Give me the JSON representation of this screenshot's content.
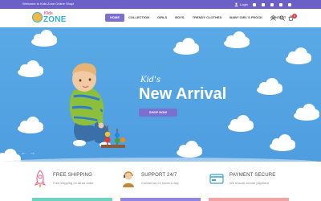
{
  "topbar": {
    "welcome": "Welcome to Kids Zone Online Shop!",
    "login": "Login",
    "socials": [
      "facebook-icon",
      "twitter-icon",
      "google-plus-icon",
      "instagram-icon",
      "pinterest-icon"
    ]
  },
  "header": {
    "logo": {
      "top": "Kids",
      "bottom": "ZONE"
    },
    "nav": [
      {
        "label": "HOME",
        "active": true
      },
      {
        "label": "COLLECTION"
      },
      {
        "label": "GIRLS"
      },
      {
        "label": "BOYS"
      },
      {
        "label": "TRENDY CLOTHES"
      },
      {
        "label": "BABY GIRL'S FROCK"
      },
      {
        "label": "CONTACT"
      }
    ],
    "icons": [
      "user-icon",
      "search-icon",
      "cart-icon"
    ],
    "cart_count": "0"
  },
  "hero": {
    "script": "Kid's",
    "headline": "New Arrival",
    "button": "SHOP NOW",
    "prev": "←",
    "next": "→"
  },
  "features": [
    {
      "title": "FREE SHIPPING",
      "subtitle": "Free shipping on all us order"
    },
    {
      "title": "SUPPORT 24/7",
      "subtitle": "Contact us 24 hours a day"
    },
    {
      "title": "PAYMENT SECURE",
      "subtitle": "We ensure secure payment"
    }
  ],
  "colors": {
    "accent": "#7b6fd1",
    "topbar": "#6c5fc7",
    "sky": "#4e9ee0",
    "logo_blue": "#2fb2d6",
    "logo_pink": "#e9528a",
    "strips": [
      "#6fd3c2",
      "#8f86e0",
      "#f2a4a4"
    ]
  }
}
